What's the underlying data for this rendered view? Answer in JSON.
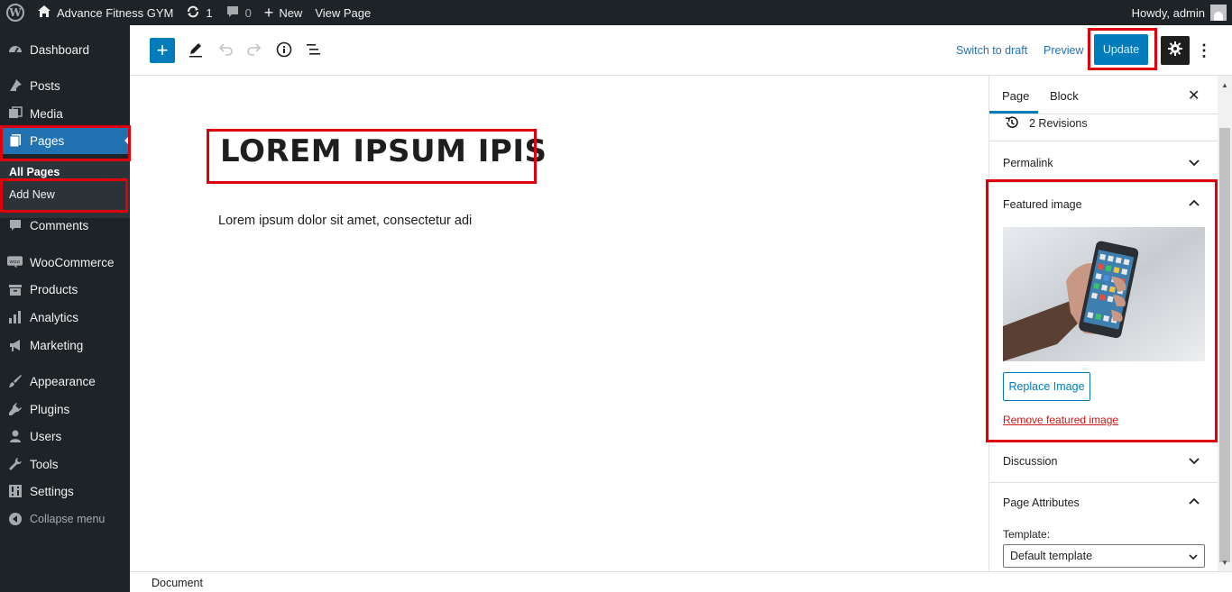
{
  "adminbar": {
    "site_name": "Advance Fitness GYM",
    "updates_count": "1",
    "comments_count": "0",
    "new_label": "New",
    "view_page_label": "View Page",
    "howdy": "Howdy, admin"
  },
  "sidebar": {
    "items": [
      {
        "label": "Dashboard",
        "icon": "dashboard-icon"
      },
      {
        "label": "Posts",
        "icon": "pin-icon"
      },
      {
        "label": "Media",
        "icon": "media-icon"
      },
      {
        "label": "Pages",
        "icon": "pages-icon"
      },
      {
        "label": "Comments",
        "icon": "comments-icon"
      },
      {
        "label": "WooCommerce",
        "icon": "woocommerce-icon"
      },
      {
        "label": "Products",
        "icon": "products-icon"
      },
      {
        "label": "Analytics",
        "icon": "analytics-icon"
      },
      {
        "label": "Marketing",
        "icon": "marketing-icon"
      },
      {
        "label": "Appearance",
        "icon": "appearance-icon"
      },
      {
        "label": "Plugins",
        "icon": "plugins-icon"
      },
      {
        "label": "Users",
        "icon": "users-icon"
      },
      {
        "label": "Tools",
        "icon": "tools-icon"
      },
      {
        "label": "Settings",
        "icon": "settings-icon"
      }
    ],
    "submenu": {
      "all_pages": "All Pages",
      "add_new": "Add New"
    },
    "collapse_label": "Collapse menu"
  },
  "header": {
    "switch_to_draft": "Switch to draft",
    "preview": "Preview",
    "update": "Update"
  },
  "editor": {
    "title": "LOREM IPSUM IPIS",
    "paragraph": "Lorem ipsum dolor sit amet, consectetur adi"
  },
  "settings_panel": {
    "tabs": [
      "Page",
      "Block"
    ],
    "revisions": "2 Revisions",
    "permalink": "Permalink",
    "featured_image": "Featured image",
    "replace_image": "Replace Image",
    "remove_featured_image": "Remove featured image",
    "discussion": "Discussion",
    "page_attributes": "Page Attributes",
    "template_label": "Template:",
    "template_value": "Default template"
  },
  "footer": {
    "breadcrumb": "Document"
  },
  "colors": {
    "accent": "#007cba",
    "highlight": "#e0000b",
    "admin_bg": "#1d2327",
    "active_menu": "#2271b1"
  }
}
